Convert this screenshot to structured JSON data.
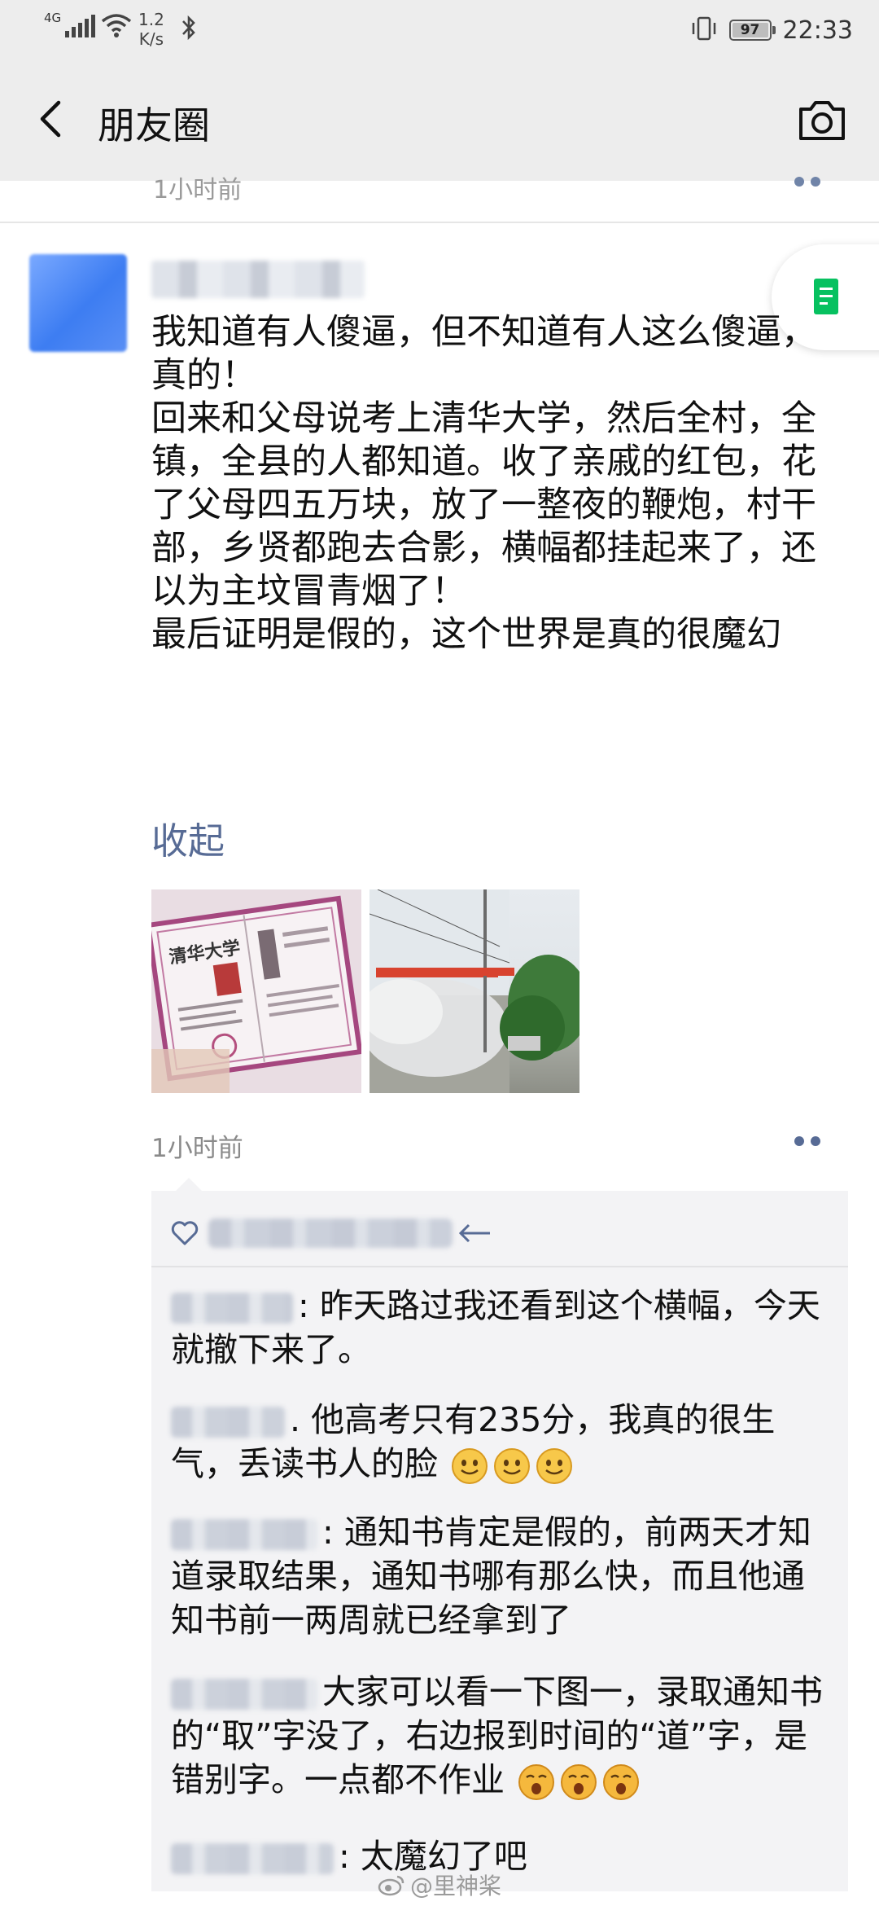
{
  "status_bar": {
    "network": "4G",
    "speed_value": "1.2",
    "speed_unit": "K/s",
    "battery": "97",
    "time": "22:33"
  },
  "header": {
    "title": "朋友圈"
  },
  "previous_post": {
    "time": "1小时前"
  },
  "post": {
    "text": "我知道有人傻逼，但不知道有人这么傻逼，真的！\n回来和父母说考上清华大学，然后全村，全镇，全县的人都知道。收了亲戚的红包，花了父母四五万块，放了一整夜的鞭炮，村干部，乡贤都跑去合影，横幅都挂起来了，还以为主坟冒青烟了！\n最后证明是假的，这个世界是真的很魔幻",
    "collapse_label": "收起",
    "time": "1小时前",
    "images": [
      {
        "label": "清华大学",
        "kind": "admission-letter-photo"
      },
      {
        "label": "",
        "kind": "banner-firecracker-photo"
      }
    ]
  },
  "comments": [
    {
      "text": ": 昨天路过我还看到这个横幅，今天就撤下来了。",
      "emoji_count": 0
    },
    {
      "text": ". 他高考只有235分，我真的很生气，丢读书人的脸",
      "emoji_count": 3
    },
    {
      "text": ": 通知书肯定是假的，前两天才知道录取结果，通知书哪有那么快，而且他通知书前一两周就已经拿到了",
      "emoji_count": 0
    },
    {
      "text": "大家可以看一下图一，录取通知书的“取”字没了，右边报到时间的“道”字，是错别字。一点都不作业",
      "emoji_count": 3
    },
    {
      "text": ": 太魔幻了吧",
      "emoji_count": 0
    }
  ],
  "watermark": "@里神桨",
  "colors": {
    "link": "#576b95",
    "header_bg": "#ededed",
    "comment_bg": "#f3f3f5"
  }
}
